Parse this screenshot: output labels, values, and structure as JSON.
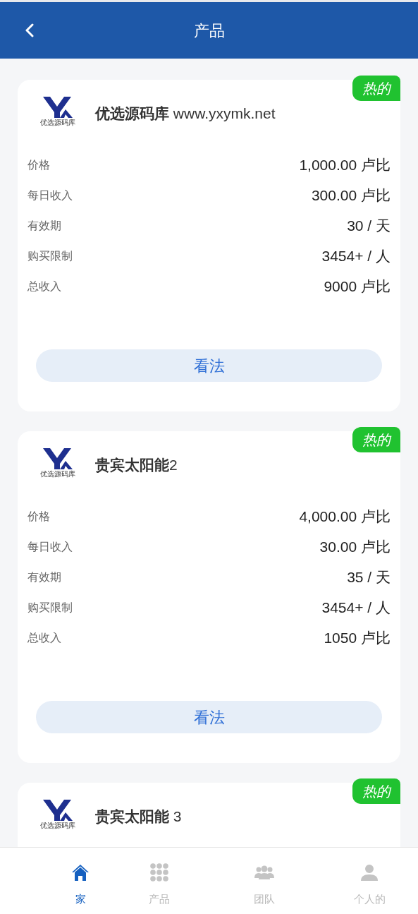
{
  "header": {
    "title": "产品"
  },
  "products": [
    {
      "badge": "热的",
      "logo": {
        "caption": "优选源码库"
      },
      "title": "**优选源码库** www.yxymk.net",
      "rows": [
        {
          "label": "价格",
          "value": "1,000.00 卢比"
        },
        {
          "label": "每日收入",
          "value": "300.00 卢比"
        },
        {
          "label": "有效期",
          "value": "30 / 天"
        },
        {
          "label": "购买限制",
          "value": "3454+ / 人"
        },
        {
          "label": "总收入",
          "value": "9000 卢比"
        }
      ],
      "button": "看法"
    },
    {
      "badge": "热的",
      "logo": {
        "caption": "优选源码库"
      },
      "title": "**贵宾太阳能**2",
      "rows": [
        {
          "label": "价格",
          "value": "4,000.00 卢比"
        },
        {
          "label": "每日收入",
          "value": "30.00 卢比"
        },
        {
          "label": "有效期",
          "value": "35 / 天"
        },
        {
          "label": "购买限制",
          "value": "3454+ / 人"
        },
        {
          "label": "总收入",
          "value": "1050 卢比"
        }
      ],
      "button": "看法"
    },
    {
      "badge": "热的",
      "logo": {
        "caption": "优选源码库"
      },
      "title": "**贵宾太阳能** 3"
    }
  ],
  "tab_bar": [
    {
      "kind": "home",
      "label": "家",
      "selected": true
    },
    {
      "kind": "grid",
      "label": "产品",
      "selected": false
    },
    {
      "kind": "team",
      "label": "团队",
      "selected": false
    },
    {
      "kind": "person",
      "label": "个人的",
      "selected": false
    }
  ]
}
